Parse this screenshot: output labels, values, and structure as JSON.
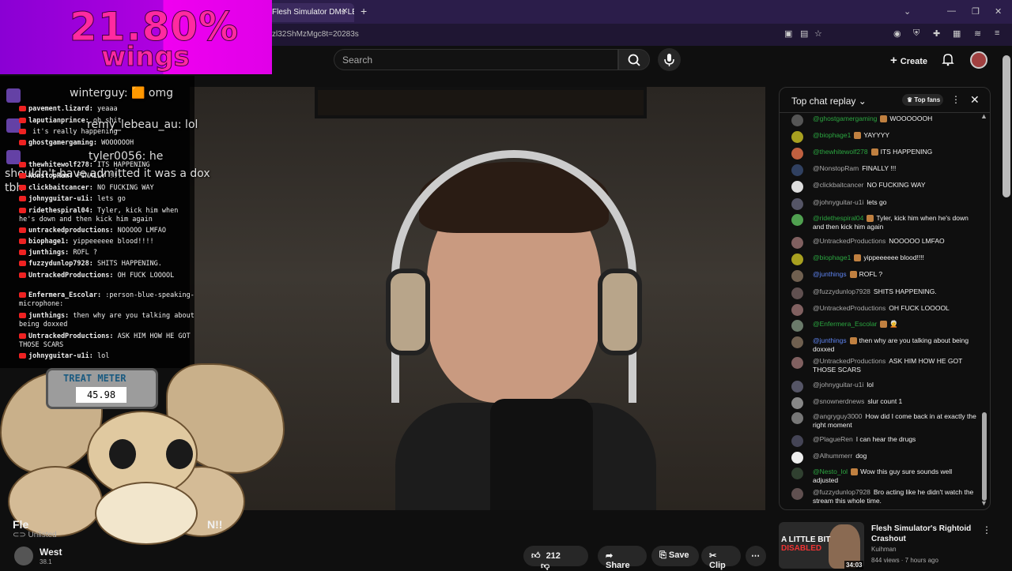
{
  "browser": {
    "tab_title": "Flesh Simulator DMs LEAKE",
    "url": "zl32ShMzMgc8t=20283s"
  },
  "header": {
    "search_placeholder": "Search",
    "create_label": "Create"
  },
  "overlay": {
    "percent": "21.80%",
    "wings": "wings",
    "floating": [
      {
        "text": "winterguy: 🟧 omg"
      },
      {
        "text": "remy_lebeau_au: lol"
      },
      {
        "text": "tyler0056: he"
      },
      {
        "text": "shouldn't have admitted it was a dox"
      },
      {
        "text": "tbh"
      }
    ],
    "chat_lines": [
      {
        "user": "pavement.lizard:",
        "msg": "yeaaa"
      },
      {
        "user": "laputianprince:",
        "msg": "oh shit"
      },
      {
        "user": "",
        "msg": "it's really happening"
      },
      {
        "user": "ghostgamergaming:",
        "msg": "WOOOOOOH"
      },
      {
        "user": "thewhitewolf278:",
        "msg": "ITS HAPPENING"
      },
      {
        "user": "NonstopRam:",
        "msg": "FINALLY !!!"
      },
      {
        "user": "clickbaitcancer:",
        "msg": "NO FUCKING WAY"
      },
      {
        "user": "johnyguitar-u1i:",
        "msg": "lets go"
      },
      {
        "user": "ridethespiral04:",
        "msg": "Tyler, kick him when he's down and then kick him again"
      },
      {
        "user": "untrackedproductions:",
        "msg": "NOOOOO LMFAO"
      },
      {
        "user": "biophage1:",
        "msg": "yippeeeeee blood!!!!"
      },
      {
        "user": "junthings:",
        "msg": "ROFL ?"
      },
      {
        "user": "fuzzydunlop7928:",
        "msg": "SHITS HAPPENING."
      },
      {
        "user": "UntrackedProductions:",
        "msg": "OH FUCK LOOOOL"
      },
      {
        "user": "Enfermera_Escolar:",
        "msg": ":person-blue-speaking-microphone:"
      },
      {
        "user": "junthings:",
        "msg": "then why are you talking about being doxxed"
      },
      {
        "user": "UntrackedProductions:",
        "msg": "ASK HIM HOW HE GOT THOSE SCARS"
      },
      {
        "user": "johnyguitar-u1i:",
        "msg": "lol"
      }
    ],
    "treat_label": "TREAT METER",
    "treat_value": "45.98"
  },
  "video": {
    "title_start": "Fle",
    "title_end": "N!!",
    "unlisted": "Unlisted",
    "channel": "West",
    "subs": "38.1",
    "likes": "212",
    "share": "Share",
    "save": "Save",
    "clip": "Clip"
  },
  "chat": {
    "title": "Top chat replay",
    "top_fans": "Top fans",
    "messages": [
      {
        "author": "@ghostgamergaming",
        "color": "g",
        "badge": true,
        "text": "WOOOOOOH",
        "avatar": "#555"
      },
      {
        "author": "@biophage1",
        "color": "g",
        "badge": true,
        "text": "YAYYYY",
        "avatar": "#a8a020"
      },
      {
        "author": "@thewhitewolf278",
        "color": "g",
        "badge": true,
        "text": "ITS HAPPENING",
        "avatar": "#c06040"
      },
      {
        "author": "@NonstopRam",
        "color": "",
        "badge": false,
        "text": "FINALLY !!!",
        "avatar": "#304060"
      },
      {
        "author": "@clickbaitcancer",
        "color": "",
        "badge": false,
        "text": "NO FUCKING WAY",
        "avatar": "#ddd"
      },
      {
        "author": "@johnyguitar-u1i",
        "color": "",
        "badge": false,
        "text": "lets go",
        "avatar": "#556"
      },
      {
        "author": "@ridethespiral04",
        "color": "g",
        "badge": true,
        "text": "Tyler, kick him when he's down and then kick him again",
        "avatar": "#50a050"
      },
      {
        "author": "@UntrackedProductions",
        "color": "",
        "badge": false,
        "text": "NOOOOO LMFAO",
        "avatar": "#806060"
      },
      {
        "author": "@biophage1",
        "color": "g",
        "badge": true,
        "text": "yippeeeeee blood!!!!",
        "avatar": "#a8a020"
      },
      {
        "author": "@junthings",
        "color": "b",
        "badge": true,
        "text": "ROFL ?",
        "avatar": "#706050"
      },
      {
        "author": "@fuzzydunlop7928",
        "color": "",
        "badge": false,
        "text": "SHITS HAPPENING.",
        "avatar": "#605050"
      },
      {
        "author": "@UntrackedProductions",
        "color": "",
        "badge": false,
        "text": "OH FUCK LOOOOL",
        "avatar": "#806060"
      },
      {
        "author": "@Enfermera_Escolar",
        "color": "g",
        "badge": true,
        "text": "🧑‍🦳",
        "avatar": "#6a7a6a"
      },
      {
        "author": "@junthings",
        "color": "b",
        "badge": true,
        "text": "then why are you talking about being doxxed",
        "avatar": "#706050"
      },
      {
        "author": "@UntrackedProductions",
        "color": "",
        "badge": false,
        "text": "ASK HIM HOW HE GOT THOSE SCARS",
        "avatar": "#806060"
      },
      {
        "author": "@johnyguitar-u1i",
        "color": "",
        "badge": false,
        "text": "lol",
        "avatar": "#556"
      },
      {
        "author": "@snownerdnews",
        "color": "",
        "badge": false,
        "text": "slur count 1",
        "avatar": "#888"
      },
      {
        "author": "@angryguy3000",
        "color": "",
        "badge": false,
        "text": "How did I come back in at exactly the right moment",
        "avatar": "#777"
      },
      {
        "author": "@PlagueRen",
        "color": "",
        "badge": false,
        "text": "I can hear the drugs",
        "avatar": "#445"
      },
      {
        "author": "@Alhummerr",
        "color": "",
        "badge": false,
        "text": "dog",
        "avatar": "#eee"
      },
      {
        "author": "@Nesto_lol",
        "color": "g",
        "badge": true,
        "text": "Wow this guy sure sounds well adjusted",
        "avatar": "#304030"
      },
      {
        "author": "@fuzzydunlop7928",
        "color": "",
        "badge": false,
        "text": "Bro acting like he didn't watch the stream this whole time.",
        "avatar": "#605050"
      }
    ]
  },
  "recommended": {
    "thumb_text": "A LITTLE BIT",
    "thumb_text2": "DISABLED",
    "duration": "34:03",
    "title": "Flesh Simulator's Rightoid Crashout",
    "channel": "Kuihman",
    "meta": "844 views · 7 hours ago"
  }
}
